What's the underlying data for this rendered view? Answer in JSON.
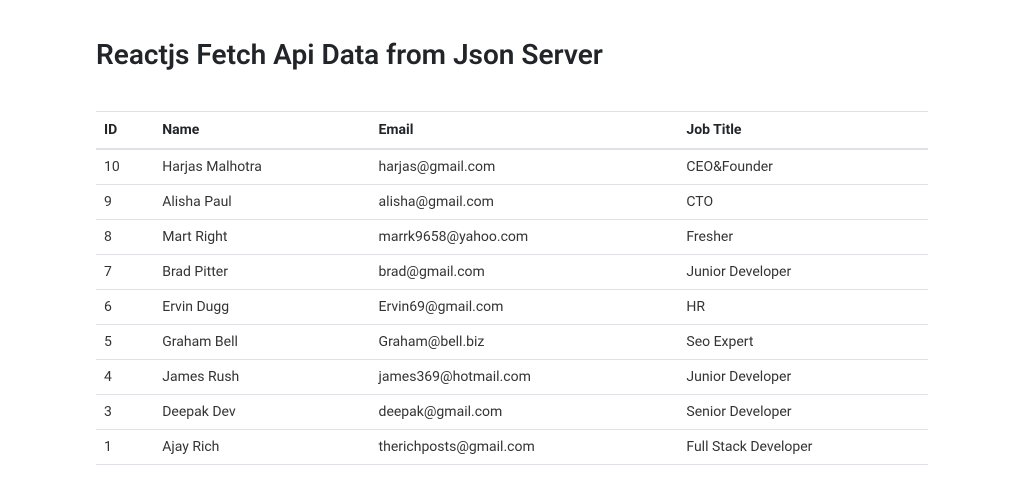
{
  "title": "Reactjs Fetch Api Data from Json Server",
  "table": {
    "headers": {
      "id": "ID",
      "name": "Name",
      "email": "Email",
      "job_title": "Job Title"
    },
    "rows": [
      {
        "id": "10",
        "name": "Harjas Malhotra",
        "email": "harjas@gmail.com",
        "job_title": "CEO&Founder"
      },
      {
        "id": "9",
        "name": "Alisha Paul",
        "email": "alisha@gmail.com",
        "job_title": "CTO"
      },
      {
        "id": "8",
        "name": "Mart Right",
        "email": "marrk9658@yahoo.com",
        "job_title": "Fresher"
      },
      {
        "id": "7",
        "name": "Brad Pitter",
        "email": "brad@gmail.com",
        "job_title": "Junior Developer"
      },
      {
        "id": "6",
        "name": "Ervin Dugg",
        "email": "Ervin69@gmail.com",
        "job_title": "HR"
      },
      {
        "id": "5",
        "name": "Graham Bell",
        "email": "Graham@bell.biz",
        "job_title": "Seo Expert"
      },
      {
        "id": "4",
        "name": "James Rush",
        "email": "james369@hotmail.com",
        "job_title": "Junior Developer"
      },
      {
        "id": "3",
        "name": "Deepak Dev",
        "email": "deepak@gmail.com",
        "job_title": "Senior Developer"
      },
      {
        "id": "1",
        "name": "Ajay Rich",
        "email": "therichposts@gmail.com",
        "job_title": "Full Stack Developer"
      }
    ]
  }
}
